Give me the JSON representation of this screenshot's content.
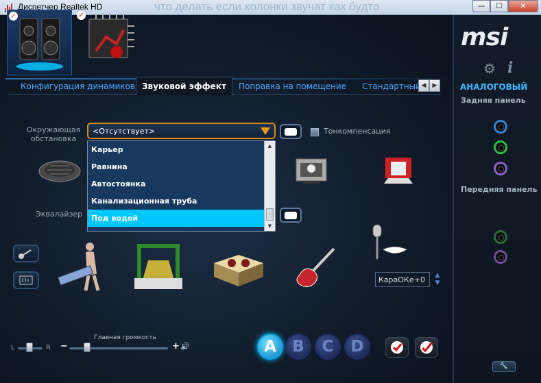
{
  "window": {
    "title": "Диспетчер Realtek HD",
    "ghost_text": "что делать если колонки звучат как будто",
    "minimize": "—",
    "maximize": "☐",
    "close": "✕"
  },
  "devices": [
    {
      "check": "✓"
    },
    {
      "check": "✓"
    }
  ],
  "tabs": [
    {
      "label": "Конфигурация динамиков",
      "active": false
    },
    {
      "label": "Звуковой эффект",
      "active": true
    },
    {
      "label": "Поправка на помещение",
      "active": false
    },
    {
      "label": "Стандартный ф",
      "active": false
    }
  ],
  "tab_arrows": {
    "left": "◀",
    "right": "▶"
  },
  "environment": {
    "label": "Окружающая обстановка",
    "selected": "<Отсутствует>",
    "options": [
      "Карьер",
      "Равнина",
      "Автостоянка",
      "Канализационная труба",
      "Под водой"
    ],
    "selected_option_index": 4
  },
  "loudness": {
    "label": "Тонкомпенсация"
  },
  "equalizer": {
    "label": "Эквалайзер"
  },
  "scrollbar": {
    "up": "▲",
    "down": "▼"
  },
  "karaoke": {
    "label": "КараОКе",
    "value": "+0",
    "up": "▲",
    "down": "▼"
  },
  "balance": {
    "left": "L",
    "right": "R"
  },
  "volume": {
    "label": "Главная громкость",
    "minus": "−",
    "plus": "+",
    "speaker": "🔊",
    "level": 0.18
  },
  "presets": [
    "A",
    "B",
    "C",
    "D"
  ],
  "active_preset": "A",
  "right_panel": {
    "logo": "msi",
    "gear": "⚙",
    "info": "i",
    "mode": "АНАЛОГОВЫЙ",
    "rear_label": "Задняя панель",
    "front_label": "Передняя панель",
    "wrench": "🔧"
  },
  "colors": {
    "accent": "#00c8ff",
    "combo_border": "#d98c12",
    "tab_text": "#4aa8ff",
    "jack_blue": "#2f86d8",
    "jack_green": "#2fb84a",
    "jack_purple": "#8a5fc8",
    "jack_green_dim": "#2a6b3e",
    "jack_purple_dim": "#6e4d96"
  }
}
